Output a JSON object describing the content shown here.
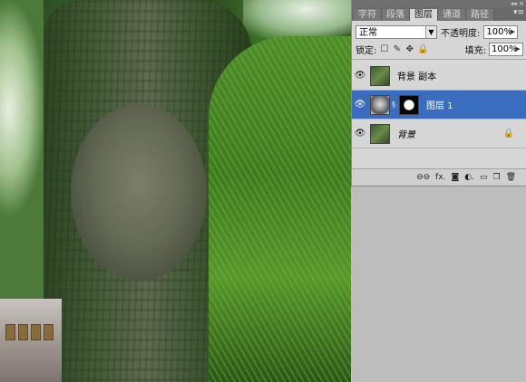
{
  "panel": {
    "tabs": [
      "字符",
      "段落",
      "图层",
      "通道",
      "路径"
    ],
    "active_tab": 2,
    "blend_mode": "正常",
    "opacity_label": "不透明度:",
    "opacity_value": "100%",
    "lock_label": "锁定:",
    "fill_label": "填充:",
    "fill_value": "100%",
    "layers": [
      {
        "name": "背景 副本",
        "visible": true,
        "selected": false
      },
      {
        "name": "图层 1",
        "visible": true,
        "selected": true,
        "has_mask": true
      },
      {
        "name": "背景",
        "visible": true,
        "selected": false,
        "locked": true
      }
    ],
    "bottom_icons": [
      "link-icon",
      "fx-icon",
      "mask-icon",
      "adjustment-icon",
      "group-icon",
      "new-layer-icon",
      "trash-icon"
    ]
  },
  "colors": {
    "panel_bg": "#d6d6d6",
    "selected_layer": "#3a6dbd",
    "tab_bar": "#6a6a6a"
  }
}
